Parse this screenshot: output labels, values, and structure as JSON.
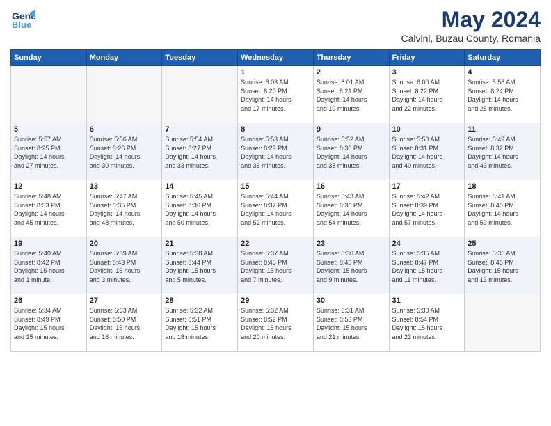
{
  "header": {
    "logo_line1": "General",
    "logo_line2": "Blue",
    "month_title": "May 2024",
    "location": "Calvini, Buzau County, Romania"
  },
  "weekdays": [
    "Sunday",
    "Monday",
    "Tuesday",
    "Wednesday",
    "Thursday",
    "Friday",
    "Saturday"
  ],
  "weeks": [
    [
      {
        "day": "",
        "info": ""
      },
      {
        "day": "",
        "info": ""
      },
      {
        "day": "",
        "info": ""
      },
      {
        "day": "1",
        "info": "Sunrise: 6:03 AM\nSunset: 8:20 PM\nDaylight: 14 hours\nand 17 minutes."
      },
      {
        "day": "2",
        "info": "Sunrise: 6:01 AM\nSunset: 8:21 PM\nDaylight: 14 hours\nand 19 minutes."
      },
      {
        "day": "3",
        "info": "Sunrise: 6:00 AM\nSunset: 8:22 PM\nDaylight: 14 hours\nand 22 minutes."
      },
      {
        "day": "4",
        "info": "Sunrise: 5:58 AM\nSunset: 8:24 PM\nDaylight: 14 hours\nand 25 minutes."
      }
    ],
    [
      {
        "day": "5",
        "info": "Sunrise: 5:57 AM\nSunset: 8:25 PM\nDaylight: 14 hours\nand 27 minutes."
      },
      {
        "day": "6",
        "info": "Sunrise: 5:56 AM\nSunset: 8:26 PM\nDaylight: 14 hours\nand 30 minutes."
      },
      {
        "day": "7",
        "info": "Sunrise: 5:54 AM\nSunset: 8:27 PM\nDaylight: 14 hours\nand 33 minutes."
      },
      {
        "day": "8",
        "info": "Sunrise: 5:53 AM\nSunset: 8:29 PM\nDaylight: 14 hours\nand 35 minutes."
      },
      {
        "day": "9",
        "info": "Sunrise: 5:52 AM\nSunset: 8:30 PM\nDaylight: 14 hours\nand 38 minutes."
      },
      {
        "day": "10",
        "info": "Sunrise: 5:50 AM\nSunset: 8:31 PM\nDaylight: 14 hours\nand 40 minutes."
      },
      {
        "day": "11",
        "info": "Sunrise: 5:49 AM\nSunset: 8:32 PM\nDaylight: 14 hours\nand 43 minutes."
      }
    ],
    [
      {
        "day": "12",
        "info": "Sunrise: 5:48 AM\nSunset: 8:33 PM\nDaylight: 14 hours\nand 45 minutes."
      },
      {
        "day": "13",
        "info": "Sunrise: 5:47 AM\nSunset: 8:35 PM\nDaylight: 14 hours\nand 48 minutes."
      },
      {
        "day": "14",
        "info": "Sunrise: 5:45 AM\nSunset: 8:36 PM\nDaylight: 14 hours\nand 50 minutes."
      },
      {
        "day": "15",
        "info": "Sunrise: 5:44 AM\nSunset: 8:37 PM\nDaylight: 14 hours\nand 52 minutes."
      },
      {
        "day": "16",
        "info": "Sunrise: 5:43 AM\nSunset: 8:38 PM\nDaylight: 14 hours\nand 54 minutes."
      },
      {
        "day": "17",
        "info": "Sunrise: 5:42 AM\nSunset: 8:39 PM\nDaylight: 14 hours\nand 57 minutes."
      },
      {
        "day": "18",
        "info": "Sunrise: 5:41 AM\nSunset: 8:40 PM\nDaylight: 14 hours\nand 59 minutes."
      }
    ],
    [
      {
        "day": "19",
        "info": "Sunrise: 5:40 AM\nSunset: 8:42 PM\nDaylight: 15 hours\nand 1 minute."
      },
      {
        "day": "20",
        "info": "Sunrise: 5:39 AM\nSunset: 8:43 PM\nDaylight: 15 hours\nand 3 minutes."
      },
      {
        "day": "21",
        "info": "Sunrise: 5:38 AM\nSunset: 8:44 PM\nDaylight: 15 hours\nand 5 minutes."
      },
      {
        "day": "22",
        "info": "Sunrise: 5:37 AM\nSunset: 8:45 PM\nDaylight: 15 hours\nand 7 minutes."
      },
      {
        "day": "23",
        "info": "Sunrise: 5:36 AM\nSunset: 8:46 PM\nDaylight: 15 hours\nand 9 minutes."
      },
      {
        "day": "24",
        "info": "Sunrise: 5:35 AM\nSunset: 8:47 PM\nDaylight: 15 hours\nand 11 minutes."
      },
      {
        "day": "25",
        "info": "Sunrise: 5:35 AM\nSunset: 8:48 PM\nDaylight: 15 hours\nand 13 minutes."
      }
    ],
    [
      {
        "day": "26",
        "info": "Sunrise: 5:34 AM\nSunset: 8:49 PM\nDaylight: 15 hours\nand 15 minutes."
      },
      {
        "day": "27",
        "info": "Sunrise: 5:33 AM\nSunset: 8:50 PM\nDaylight: 15 hours\nand 16 minutes."
      },
      {
        "day": "28",
        "info": "Sunrise: 5:32 AM\nSunset: 8:51 PM\nDaylight: 15 hours\nand 18 minutes."
      },
      {
        "day": "29",
        "info": "Sunrise: 5:32 AM\nSunset: 8:52 PM\nDaylight: 15 hours\nand 20 minutes."
      },
      {
        "day": "30",
        "info": "Sunrise: 5:31 AM\nSunset: 8:53 PM\nDaylight: 15 hours\nand 21 minutes."
      },
      {
        "day": "31",
        "info": "Sunrise: 5:30 AM\nSunset: 8:54 PM\nDaylight: 15 hours\nand 23 minutes."
      },
      {
        "day": "",
        "info": ""
      }
    ]
  ]
}
